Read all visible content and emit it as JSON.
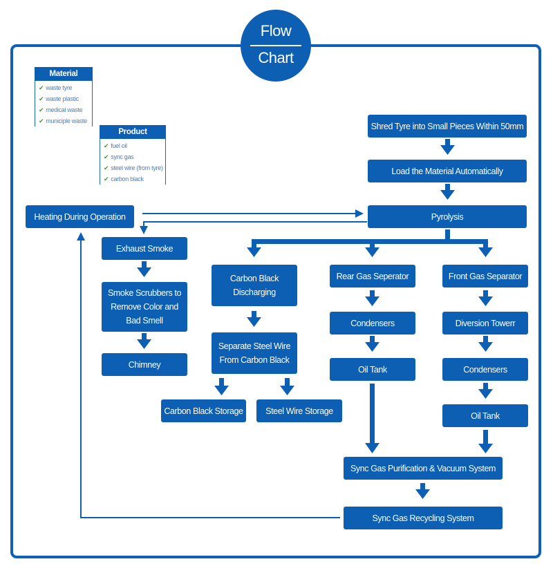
{
  "title": {
    "line1": "Flow",
    "line2": "Chart"
  },
  "legends": {
    "material": {
      "header": "Material",
      "items": [
        "waste tyre",
        "waste plastic",
        "medical waste",
        "municiple waste"
      ]
    },
    "product": {
      "header": "Product",
      "items": [
        "fuel oil",
        "sync gas",
        "steel wire (from tyre)",
        "carbon black"
      ]
    },
    "check_icon": "✔"
  },
  "nodes": {
    "shred": "Shred Tyre into Small Pieces Within 50mm",
    "load": "Load the Material Automatically",
    "pyrolysis": "Pyrolysis",
    "heating": "Heating During Operation",
    "exhaust": "Exhaust Smoke",
    "scrubbers": "Smoke Scrubbers to\nRemove Color and\nBad Smell",
    "chimney": "Chimney",
    "cb_discharging": "Carbon Black\nDischarging",
    "separate_steel": "Separate Steel Wire\nFrom Carbon Black",
    "cb_storage": "Carbon Black Storage",
    "steel_storage": "Steel Wire Storage",
    "rear_gas": "Rear Gas Seperator",
    "rear_condensers": "Condensers",
    "rear_oil_tank": "Oil Tank",
    "front_gas": "Front  Gas Separator",
    "diversion": "Diversion Towerr",
    "front_condensers": "Condensers",
    "front_oil_tank": "Oil Tank",
    "purification": "Sync Gas Purification & Vacuum System",
    "recycling": "Sync Gas Recycling System"
  },
  "colors": {
    "primary": "#0d5fb4",
    "frame": "#1060b6",
    "check": "#3aa02e",
    "legend_text": "#4a7fc0"
  }
}
